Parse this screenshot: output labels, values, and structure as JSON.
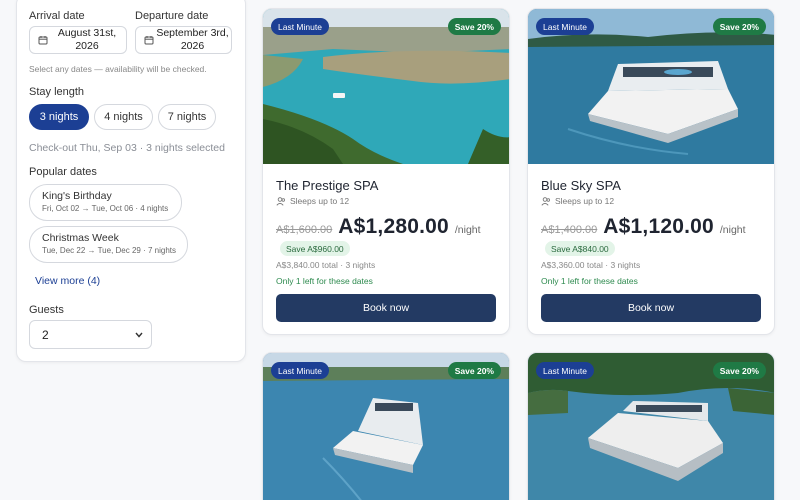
{
  "search": {
    "arrival_label": "Arrival date",
    "arrival_value": "August 31st, 2026",
    "departure_label": "Departure date",
    "departure_value": "September 3rd, 2026",
    "hint": "Select any dates — availability will be checked."
  },
  "stay_length": {
    "title": "Stay length",
    "options": [
      "3 nights",
      "4 nights",
      "7 nights"
    ],
    "selected": "3 nights",
    "checkout_text": "Check-out Thu, Sep 03 · 3 nights selected"
  },
  "popular_dates": {
    "title": "Popular dates",
    "items": [
      {
        "name": "King's Birthday",
        "detail": "Fri, Oct 02 → Tue, Oct 06 · 4 nights"
      },
      {
        "name": "Christmas Week",
        "detail": "Tue, Dec 22 → Tue, Dec 29 · 7 nights"
      }
    ],
    "view_more": "View more (4)"
  },
  "guests": {
    "label": "Guests",
    "value": "2"
  },
  "listings": [
    {
      "badge": "Last Minute",
      "discount": "Save 20%",
      "name": "The Prestige SPA",
      "sleeps": "Sleeps up to 12",
      "old_price": "A$1,600.00",
      "price": "A$1,280.00",
      "unit": "/night",
      "save": "Save A$960.00",
      "total": "A$3,840.00 total · 3 nights",
      "availability": "Only 1 left for these dates",
      "cta": "Book now"
    },
    {
      "badge": "Last Minute",
      "discount": "Save 20%",
      "name": "Blue Sky SPA",
      "sleeps": "Sleeps up to 12",
      "old_price": "A$1,400.00",
      "price": "A$1,120.00",
      "unit": "/night",
      "save": "Save A$840.00",
      "total": "A$3,360.00 total · 3 nights",
      "availability": "Only 1 left for these dates",
      "cta": "Book now"
    },
    {
      "badge": "Last Minute",
      "discount": "Save 20%"
    },
    {
      "badge": "Last Minute",
      "discount": "Save 20%"
    }
  ],
  "colors": {
    "primary": "#1c3f94",
    "button": "#233a63",
    "success": "#1f7a45",
    "availability": "#2d8a4e"
  }
}
